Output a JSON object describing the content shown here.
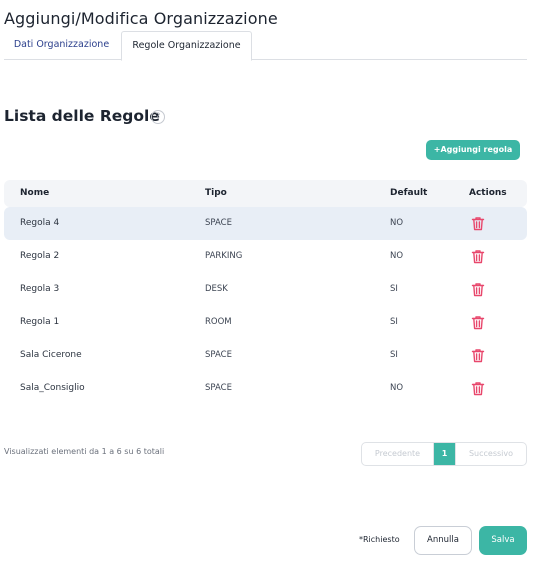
{
  "header": {
    "title": "Aggiungi/Modifica Organizzazione"
  },
  "tabs": [
    {
      "label": "Dati Organizzazione",
      "active": false
    },
    {
      "label": "Regole Organizzazione",
      "active": true
    }
  ],
  "section": {
    "title": "Lista delle Regole",
    "help_icon": "?"
  },
  "toolbar": {
    "add_label": "+Aggiungi regola"
  },
  "table": {
    "columns": [
      "Nome",
      "Tipo",
      "Default",
      "Actions"
    ],
    "rows": [
      {
        "nome": "Regola 4",
        "tipo": "SPACE",
        "default": "NO",
        "highlighted": true
      },
      {
        "nome": "Regola 2",
        "tipo": "PARKING",
        "default": "NO",
        "highlighted": false
      },
      {
        "nome": "Regola 3",
        "tipo": "DESK",
        "default": "SI",
        "highlighted": false
      },
      {
        "nome": "Regola 1",
        "tipo": "ROOM",
        "default": "SI",
        "highlighted": false
      },
      {
        "nome": "Sala Cicerone",
        "tipo": "SPACE",
        "default": "SI",
        "highlighted": false
      },
      {
        "nome": "Sala_Consiglio",
        "tipo": "SPACE",
        "default": "NO",
        "highlighted": false
      }
    ],
    "action_icon": "trash-icon"
  },
  "footer_info": "Visualizzati elementi da 1 a 6 su 6 totali",
  "pagination": {
    "prev": "Precedente",
    "page": "1",
    "next": "Successivo"
  },
  "form": {
    "required_note": "*Richiesto",
    "cancel_label": "Annulla",
    "save_label": "Salva"
  },
  "colors": {
    "accent": "#3cb6a5",
    "danger": "#e8476c",
    "tab_link": "#2b3f8c",
    "highlight_row": "#e8eef6"
  }
}
